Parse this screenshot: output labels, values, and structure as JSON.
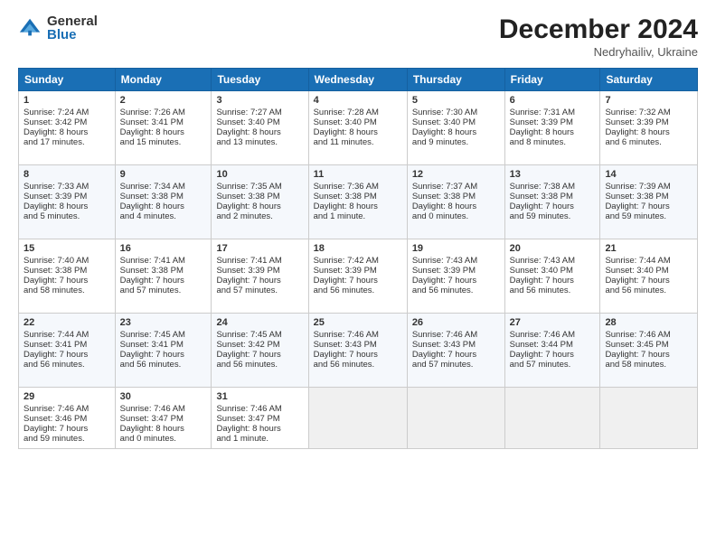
{
  "header": {
    "logo_general": "General",
    "logo_blue": "Blue",
    "month": "December 2024",
    "location": "Nedryhailiv, Ukraine"
  },
  "days_header": [
    "Sunday",
    "Monday",
    "Tuesday",
    "Wednesday",
    "Thursday",
    "Friday",
    "Saturday"
  ],
  "weeks": [
    [
      {
        "day": "1",
        "lines": [
          "Sunrise: 7:24 AM",
          "Sunset: 3:42 PM",
          "Daylight: 8 hours",
          "and 17 minutes."
        ]
      },
      {
        "day": "2",
        "lines": [
          "Sunrise: 7:26 AM",
          "Sunset: 3:41 PM",
          "Daylight: 8 hours",
          "and 15 minutes."
        ]
      },
      {
        "day": "3",
        "lines": [
          "Sunrise: 7:27 AM",
          "Sunset: 3:40 PM",
          "Daylight: 8 hours",
          "and 13 minutes."
        ]
      },
      {
        "day": "4",
        "lines": [
          "Sunrise: 7:28 AM",
          "Sunset: 3:40 PM",
          "Daylight: 8 hours",
          "and 11 minutes."
        ]
      },
      {
        "day": "5",
        "lines": [
          "Sunrise: 7:30 AM",
          "Sunset: 3:40 PM",
          "Daylight: 8 hours",
          "and 9 minutes."
        ]
      },
      {
        "day": "6",
        "lines": [
          "Sunrise: 7:31 AM",
          "Sunset: 3:39 PM",
          "Daylight: 8 hours",
          "and 8 minutes."
        ]
      },
      {
        "day": "7",
        "lines": [
          "Sunrise: 7:32 AM",
          "Sunset: 3:39 PM",
          "Daylight: 8 hours",
          "and 6 minutes."
        ]
      }
    ],
    [
      {
        "day": "8",
        "lines": [
          "Sunrise: 7:33 AM",
          "Sunset: 3:39 PM",
          "Daylight: 8 hours",
          "and 5 minutes."
        ]
      },
      {
        "day": "9",
        "lines": [
          "Sunrise: 7:34 AM",
          "Sunset: 3:38 PM",
          "Daylight: 8 hours",
          "and 4 minutes."
        ]
      },
      {
        "day": "10",
        "lines": [
          "Sunrise: 7:35 AM",
          "Sunset: 3:38 PM",
          "Daylight: 8 hours",
          "and 2 minutes."
        ]
      },
      {
        "day": "11",
        "lines": [
          "Sunrise: 7:36 AM",
          "Sunset: 3:38 PM",
          "Daylight: 8 hours",
          "and 1 minute."
        ]
      },
      {
        "day": "12",
        "lines": [
          "Sunrise: 7:37 AM",
          "Sunset: 3:38 PM",
          "Daylight: 8 hours",
          "and 0 minutes."
        ]
      },
      {
        "day": "13",
        "lines": [
          "Sunrise: 7:38 AM",
          "Sunset: 3:38 PM",
          "Daylight: 7 hours",
          "and 59 minutes."
        ]
      },
      {
        "day": "14",
        "lines": [
          "Sunrise: 7:39 AM",
          "Sunset: 3:38 PM",
          "Daylight: 7 hours",
          "and 59 minutes."
        ]
      }
    ],
    [
      {
        "day": "15",
        "lines": [
          "Sunrise: 7:40 AM",
          "Sunset: 3:38 PM",
          "Daylight: 7 hours",
          "and 58 minutes."
        ]
      },
      {
        "day": "16",
        "lines": [
          "Sunrise: 7:41 AM",
          "Sunset: 3:38 PM",
          "Daylight: 7 hours",
          "and 57 minutes."
        ]
      },
      {
        "day": "17",
        "lines": [
          "Sunrise: 7:41 AM",
          "Sunset: 3:39 PM",
          "Daylight: 7 hours",
          "and 57 minutes."
        ]
      },
      {
        "day": "18",
        "lines": [
          "Sunrise: 7:42 AM",
          "Sunset: 3:39 PM",
          "Daylight: 7 hours",
          "and 56 minutes."
        ]
      },
      {
        "day": "19",
        "lines": [
          "Sunrise: 7:43 AM",
          "Sunset: 3:39 PM",
          "Daylight: 7 hours",
          "and 56 minutes."
        ]
      },
      {
        "day": "20",
        "lines": [
          "Sunrise: 7:43 AM",
          "Sunset: 3:40 PM",
          "Daylight: 7 hours",
          "and 56 minutes."
        ]
      },
      {
        "day": "21",
        "lines": [
          "Sunrise: 7:44 AM",
          "Sunset: 3:40 PM",
          "Daylight: 7 hours",
          "and 56 minutes."
        ]
      }
    ],
    [
      {
        "day": "22",
        "lines": [
          "Sunrise: 7:44 AM",
          "Sunset: 3:41 PM",
          "Daylight: 7 hours",
          "and 56 minutes."
        ]
      },
      {
        "day": "23",
        "lines": [
          "Sunrise: 7:45 AM",
          "Sunset: 3:41 PM",
          "Daylight: 7 hours",
          "and 56 minutes."
        ]
      },
      {
        "day": "24",
        "lines": [
          "Sunrise: 7:45 AM",
          "Sunset: 3:42 PM",
          "Daylight: 7 hours",
          "and 56 minutes."
        ]
      },
      {
        "day": "25",
        "lines": [
          "Sunrise: 7:46 AM",
          "Sunset: 3:43 PM",
          "Daylight: 7 hours",
          "and 56 minutes."
        ]
      },
      {
        "day": "26",
        "lines": [
          "Sunrise: 7:46 AM",
          "Sunset: 3:43 PM",
          "Daylight: 7 hours",
          "and 57 minutes."
        ]
      },
      {
        "day": "27",
        "lines": [
          "Sunrise: 7:46 AM",
          "Sunset: 3:44 PM",
          "Daylight: 7 hours",
          "and 57 minutes."
        ]
      },
      {
        "day": "28",
        "lines": [
          "Sunrise: 7:46 AM",
          "Sunset: 3:45 PM",
          "Daylight: 7 hours",
          "and 58 minutes."
        ]
      }
    ],
    [
      {
        "day": "29",
        "lines": [
          "Sunrise: 7:46 AM",
          "Sunset: 3:46 PM",
          "Daylight: 7 hours",
          "and 59 minutes."
        ]
      },
      {
        "day": "30",
        "lines": [
          "Sunrise: 7:46 AM",
          "Sunset: 3:47 PM",
          "Daylight: 8 hours",
          "and 0 minutes."
        ]
      },
      {
        "day": "31",
        "lines": [
          "Sunrise: 7:46 AM",
          "Sunset: 3:47 PM",
          "Daylight: 8 hours",
          "and 1 minute."
        ]
      },
      null,
      null,
      null,
      null
    ]
  ]
}
